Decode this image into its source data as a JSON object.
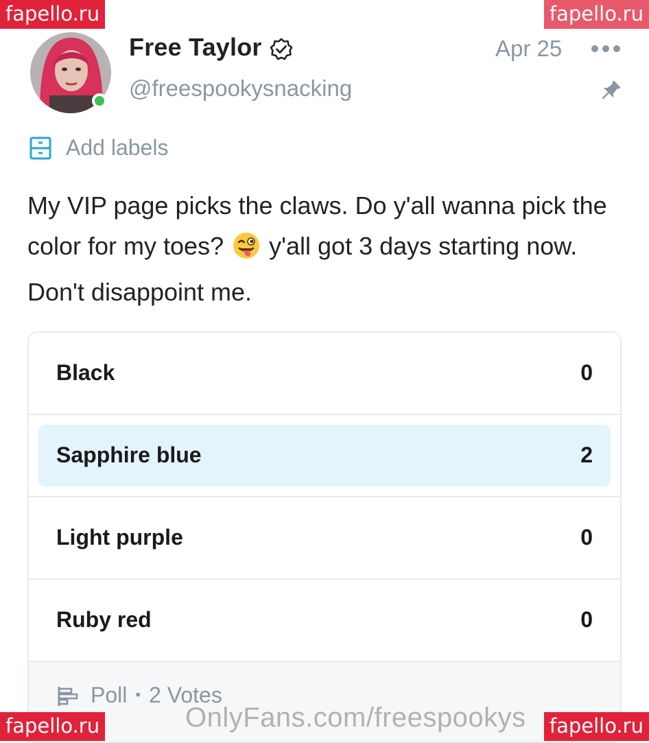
{
  "watermarks": {
    "top_left": "fapello.ru",
    "top_right": "fapello.ru",
    "bottom_left": "fapello.ru",
    "bottom_right": "fapello.ru",
    "overlay": "OnlyFans.com/freespookys"
  },
  "post": {
    "author_name": "Free Taylor",
    "handle": "@freespookysnacking",
    "date": "Apr 25",
    "online": true,
    "labels_action": "Add labels",
    "text_part1": "My VIP page picks the claws. Do y'all wanna pick the color for my toes?",
    "text_part2": "y'all got 3 days starting now. Don't disappoint me."
  },
  "poll": {
    "options": [
      {
        "label": "Black",
        "count": "0",
        "selected": false
      },
      {
        "label": "Sapphire blue",
        "count": "2",
        "selected": true
      },
      {
        "label": "Light purple",
        "count": "0",
        "selected": false
      },
      {
        "label": "Ruby red",
        "count": "0",
        "selected": false
      }
    ],
    "type_label": "Poll",
    "votes_label": "2 Votes"
  },
  "colors": {
    "accent": "#00aff0",
    "muted": "#8a96a3",
    "selected_bg": "#e3f4fc",
    "online": "#3fbd5a",
    "watermark": "#e0223a"
  },
  "icons": [
    "verified-icon",
    "more-icon",
    "pin-icon",
    "labels-icon",
    "poll-icon",
    "winking-face-emoji"
  ]
}
